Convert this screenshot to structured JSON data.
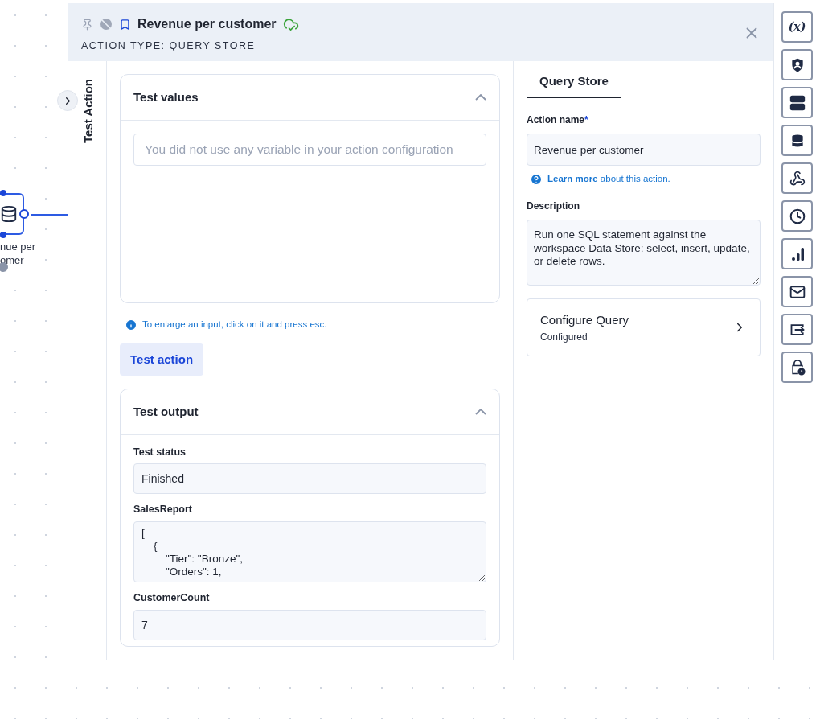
{
  "canvas": {
    "node_label": "nue per omer"
  },
  "header": {
    "title": "Revenue per customer",
    "subtitle": "ACTION TYPE: QUERY STORE",
    "saved": true
  },
  "side_tab": {
    "label": "Test Action"
  },
  "test_values": {
    "title": "Test values",
    "expanded": true,
    "placeholder": "You did not use any variable in your action configuration"
  },
  "hint": "To enlarge an input, click on it and press esc.",
  "test_button": "Test action",
  "test_output": {
    "title": "Test output",
    "expanded": true,
    "fields": [
      {
        "label": "Test status",
        "kind": "input",
        "value": "Finished"
      },
      {
        "label": "SalesReport",
        "kind": "textarea",
        "value": "[\n    {\n        \"Tier\": \"Bronze\",\n        \"Orders\": 1,"
      },
      {
        "label": "CustomerCount",
        "kind": "input",
        "value": "7"
      }
    ]
  },
  "config": {
    "tabs": [
      {
        "label": "Query Store",
        "selected": true
      }
    ],
    "action_name": {
      "label": "Action name",
      "required_mark": "*",
      "value": "Revenue per customer"
    },
    "help": "**Learn more** about this action.",
    "description": {
      "label": "Description",
      "value": "Run one SQL statement against the workspace Data Store: select, insert, update, or delete rows."
    },
    "configure": {
      "title": "Configure Query",
      "status": "Configured"
    }
  },
  "toolbar": {
    "variable_button": "(x)"
  }
}
